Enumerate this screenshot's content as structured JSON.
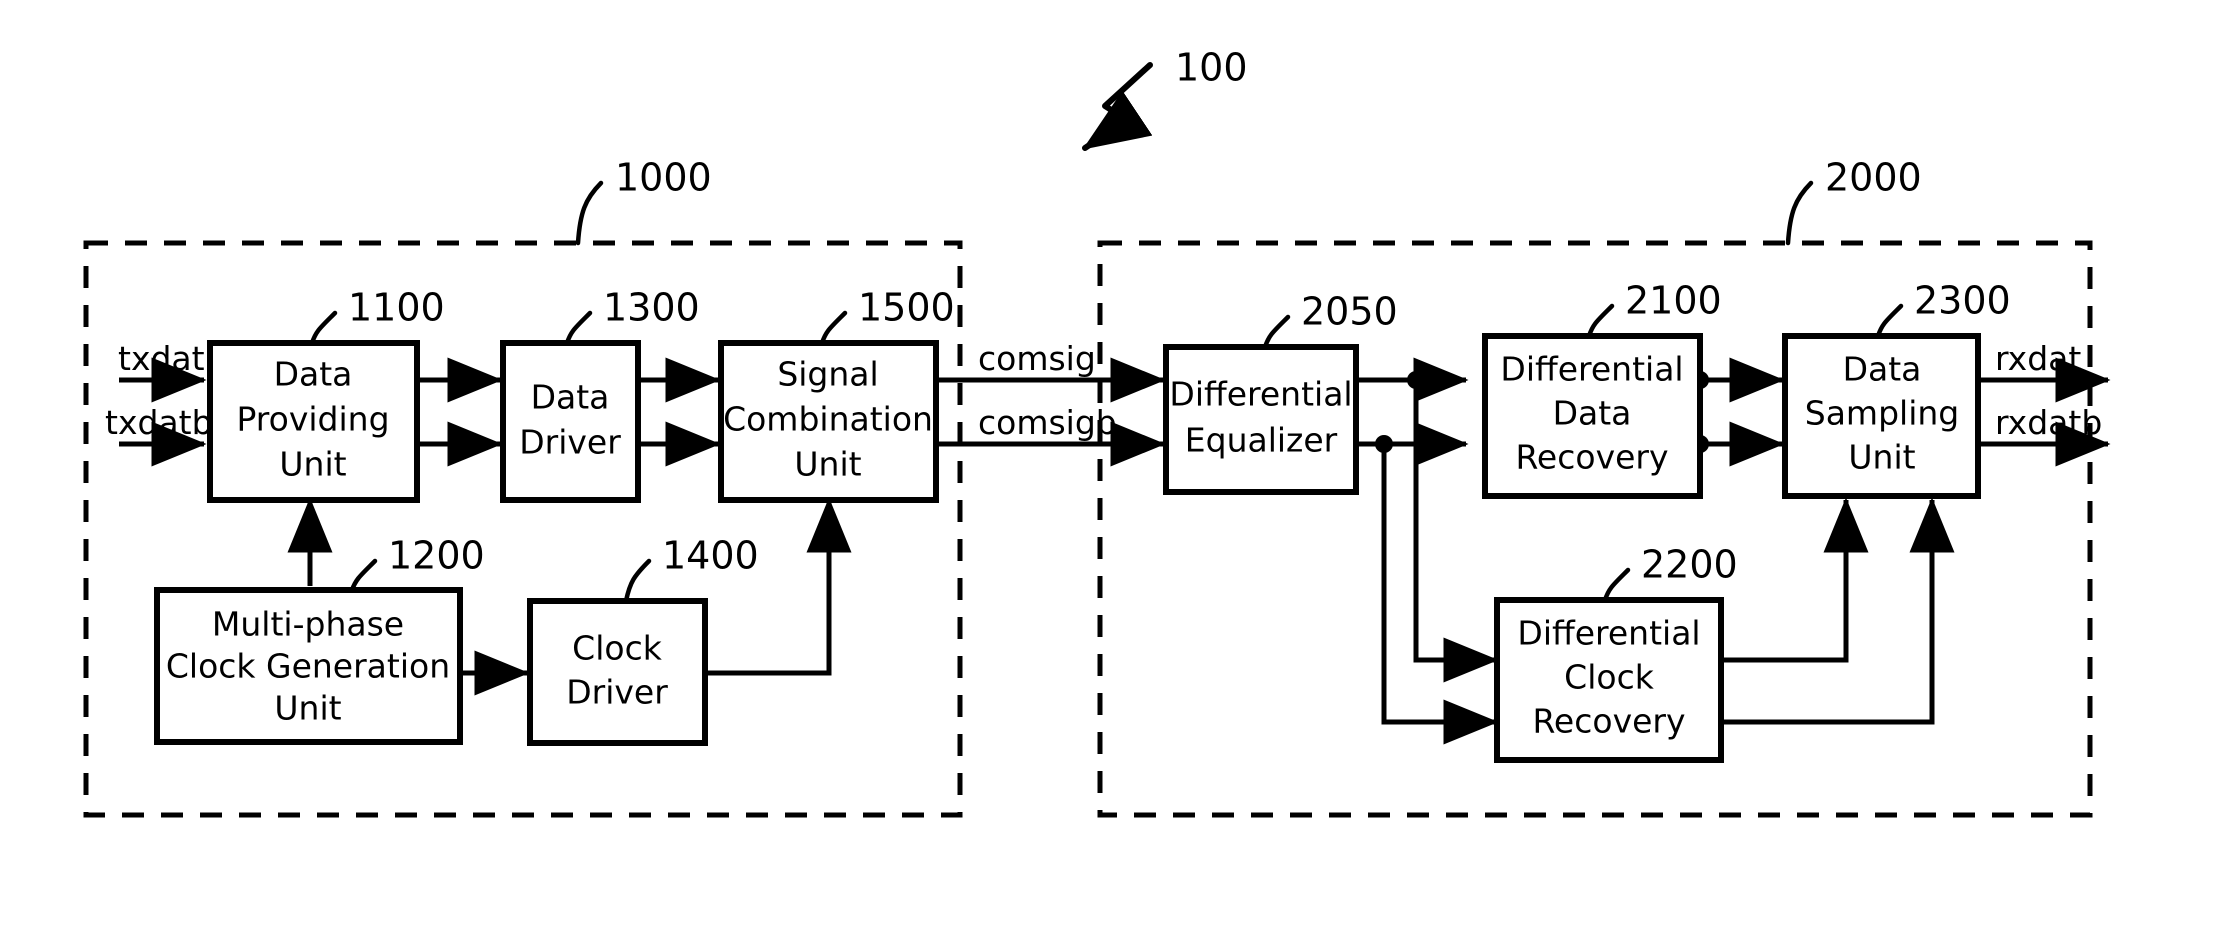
{
  "figure": {
    "top_reference": "100",
    "background_color": "#ffffff",
    "line_color": "#000000"
  },
  "groups": [
    {
      "id": "transmitter",
      "ref": "1000"
    },
    {
      "id": "receiver",
      "ref": "2000"
    }
  ],
  "blocks": [
    {
      "id": "data-providing-unit",
      "ref": "1100",
      "lines": [
        "Data",
        "Providing",
        "Unit"
      ]
    },
    {
      "id": "multi-phase-clock-gen-unit",
      "ref": "1200",
      "lines": [
        "Multi-phase",
        "Clock Generation",
        "Unit"
      ]
    },
    {
      "id": "data-driver",
      "ref": "1300",
      "lines": [
        "Data",
        "Driver"
      ]
    },
    {
      "id": "clock-driver",
      "ref": "1400",
      "lines": [
        "Clock",
        "Driver"
      ]
    },
    {
      "id": "signal-combination-unit",
      "ref": "1500",
      "lines": [
        "Signal",
        "Combination",
        "Unit"
      ]
    },
    {
      "id": "differential-equalizer",
      "ref": "2050",
      "lines": [
        "Differential",
        "Equalizer"
      ]
    },
    {
      "id": "differential-data-recovery",
      "ref": "2100",
      "lines": [
        "Differential",
        "Data",
        "Recovery"
      ]
    },
    {
      "id": "differential-clock-recovery",
      "ref": "2200",
      "lines": [
        "Differential",
        "Clock",
        "Recovery"
      ]
    },
    {
      "id": "data-sampling-unit",
      "ref": "2300",
      "lines": [
        "Data",
        "Sampling",
        "Unit"
      ]
    }
  ],
  "signals": {
    "tx_in_true": "txdat",
    "tx_in_comp": "txdatb",
    "channel_true": "comsig",
    "channel_comp": "comsigb",
    "rx_out_true": "rxdat",
    "rx_out_comp": "rxdatb"
  }
}
